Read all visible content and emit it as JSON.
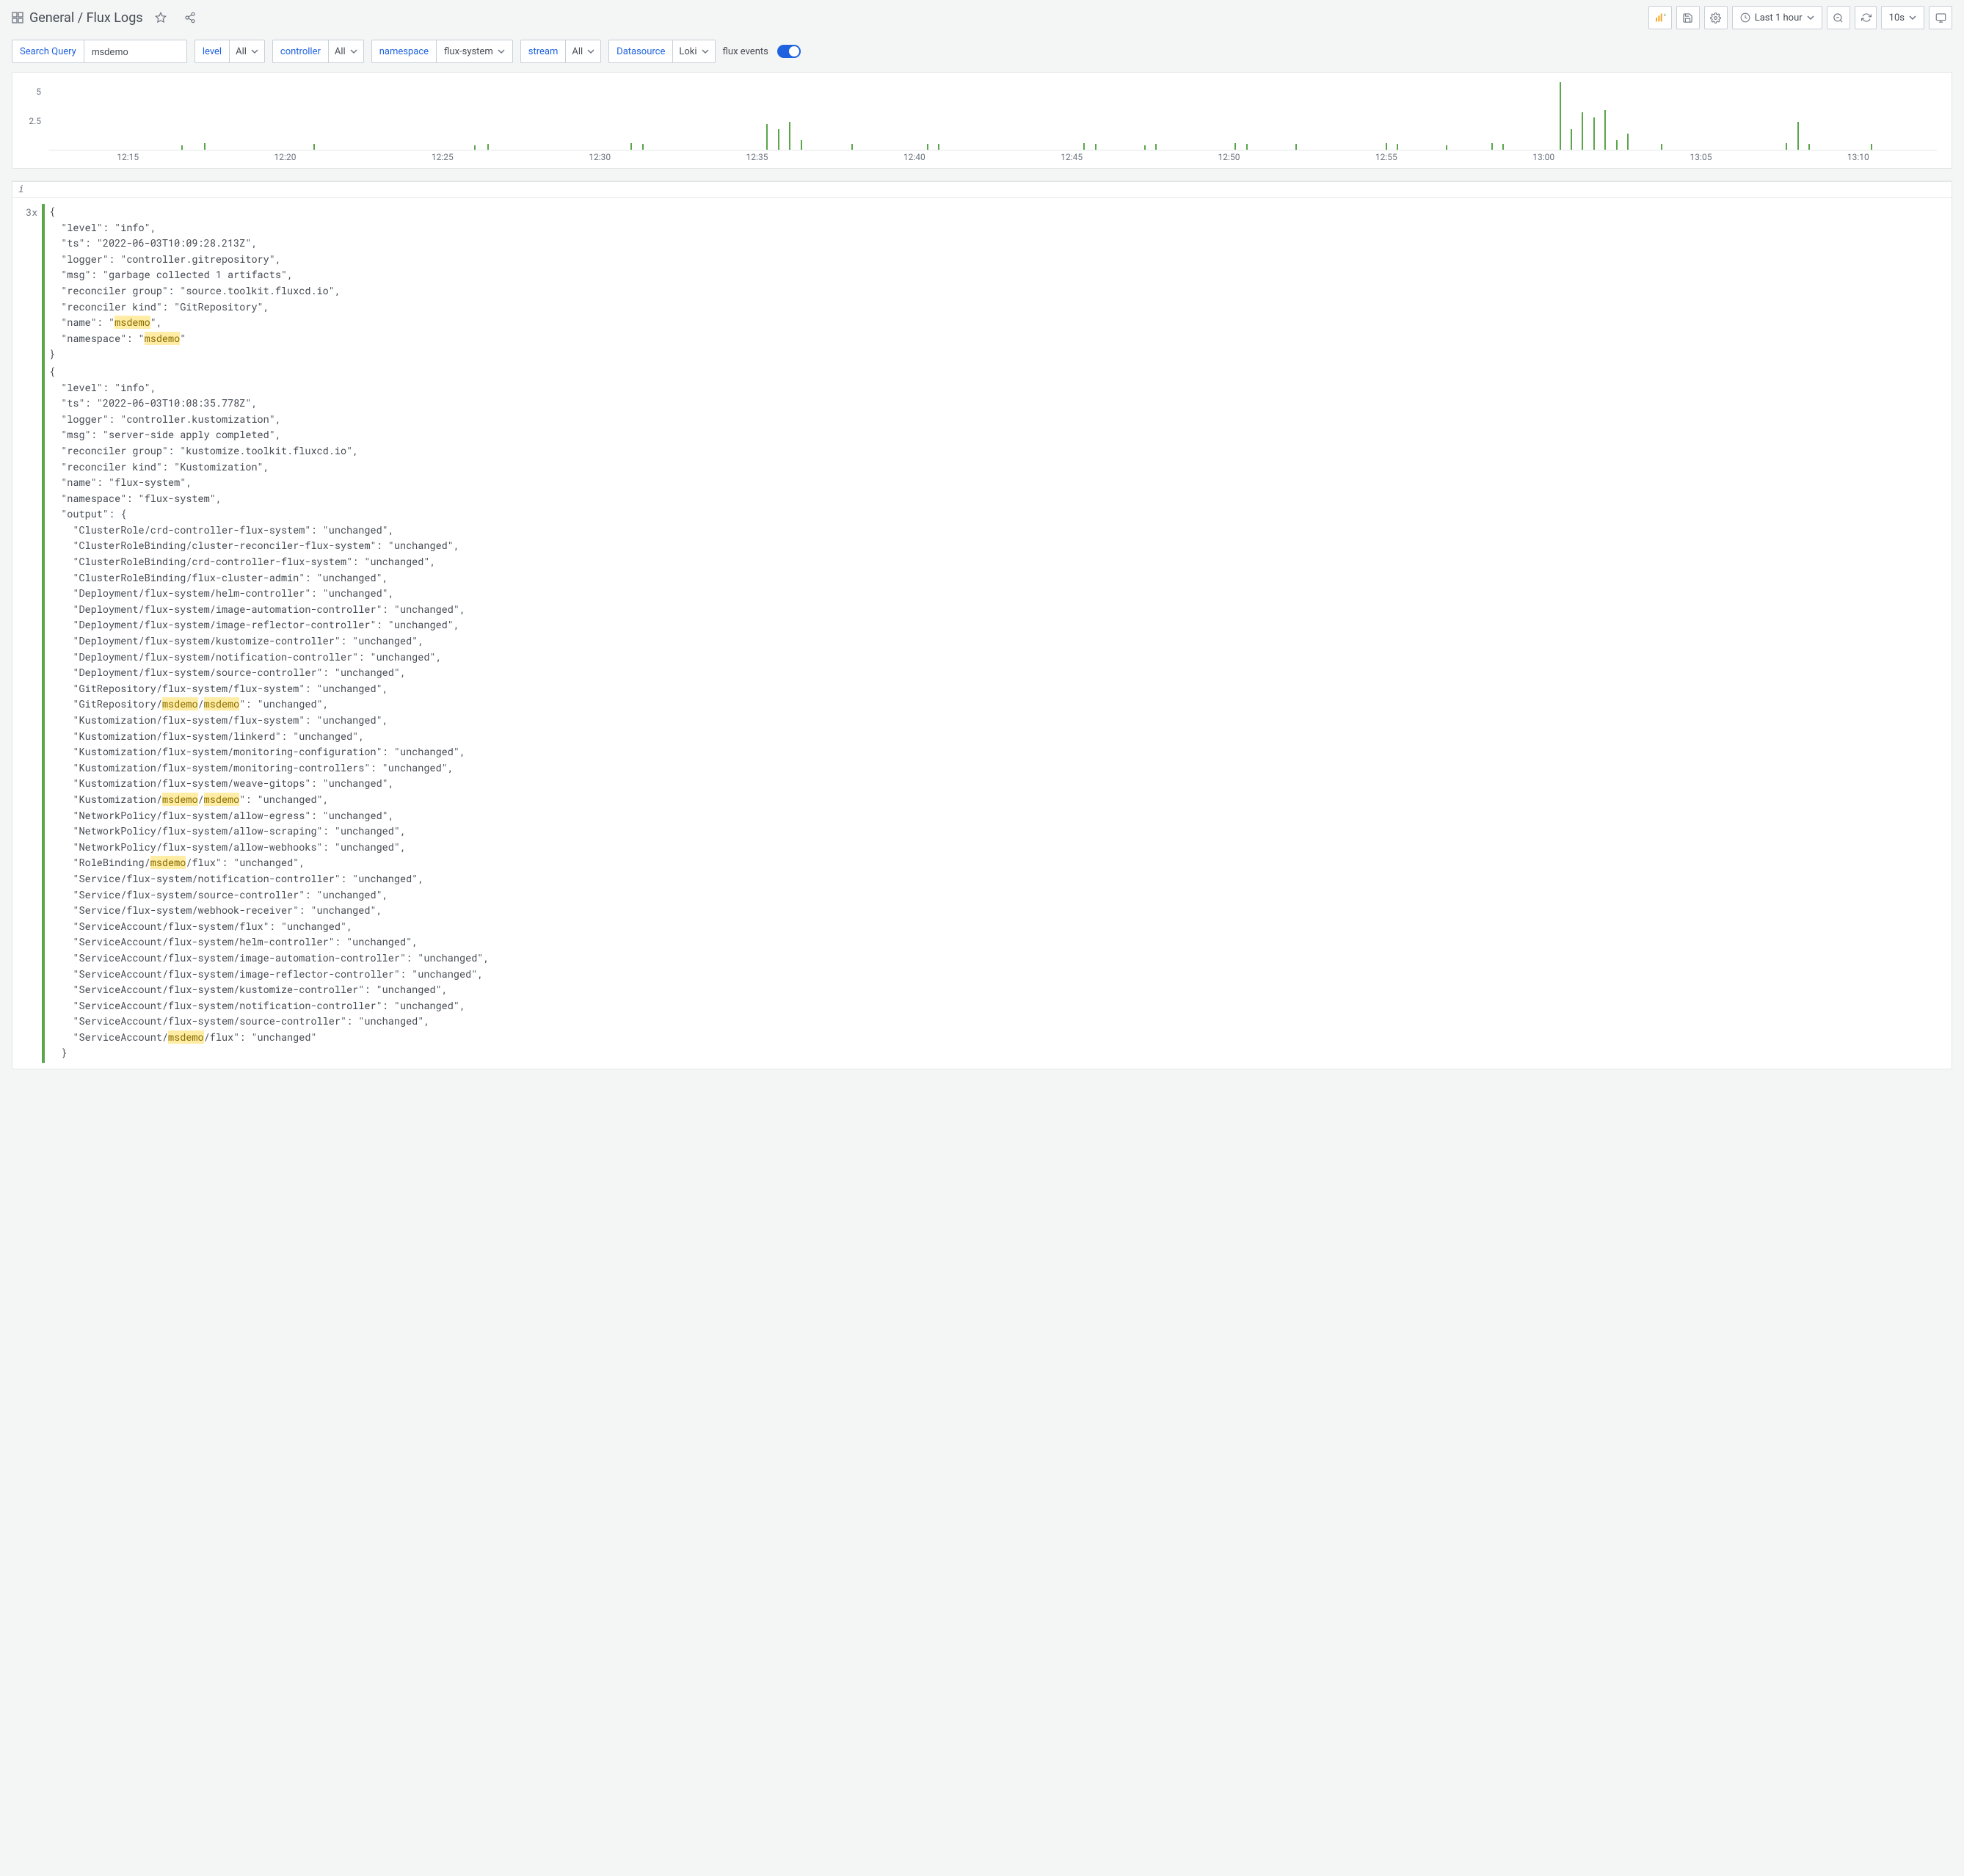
{
  "breadcrumb": {
    "root": "General",
    "page": "Flux Logs"
  },
  "topbar": {
    "time_range": "Last 1 hour",
    "refresh_interval": "10s"
  },
  "filters": {
    "search_label": "Search Query",
    "search_value": "msdemo",
    "level_label": "level",
    "level_value": "All",
    "controller_label": "controller",
    "controller_value": "All",
    "namespace_label": "namespace",
    "namespace_value": "flux-system",
    "stream_label": "stream",
    "stream_value": "All",
    "datasource_label": "Datasource",
    "datasource_value": "Loki",
    "toggle_label": "flux events"
  },
  "info_char": "i",
  "chart_data": {
    "type": "bar",
    "title": "",
    "xlabel": "",
    "ylabel": "",
    "ylim": [
      0,
      6
    ],
    "y_ticks": [
      2.5,
      5
    ],
    "x_ticks": [
      "12:15",
      "12:20",
      "12:25",
      "12:30",
      "12:35",
      "12:40",
      "12:45",
      "12:50",
      "12:55",
      "13:00",
      "13:05",
      "13:10"
    ],
    "x_range": [
      "12:11",
      "13:12"
    ],
    "bars": [
      {
        "x_pct": 7.0,
        "value": 0.4
      },
      {
        "x_pct": 8.2,
        "value": 0.6
      },
      {
        "x_pct": 14.0,
        "value": 0.5
      },
      {
        "x_pct": 22.5,
        "value": 0.4
      },
      {
        "x_pct": 23.2,
        "value": 0.5
      },
      {
        "x_pct": 30.8,
        "value": 0.6
      },
      {
        "x_pct": 31.4,
        "value": 0.5
      },
      {
        "x_pct": 38.0,
        "value": 2.2
      },
      {
        "x_pct": 38.6,
        "value": 1.8
      },
      {
        "x_pct": 39.2,
        "value": 2.4
      },
      {
        "x_pct": 39.8,
        "value": 0.8
      },
      {
        "x_pct": 42.5,
        "value": 0.5
      },
      {
        "x_pct": 46.5,
        "value": 0.5
      },
      {
        "x_pct": 47.1,
        "value": 0.5
      },
      {
        "x_pct": 54.8,
        "value": 0.6
      },
      {
        "x_pct": 55.4,
        "value": 0.5
      },
      {
        "x_pct": 58.0,
        "value": 0.4
      },
      {
        "x_pct": 58.6,
        "value": 0.5
      },
      {
        "x_pct": 62.8,
        "value": 0.6
      },
      {
        "x_pct": 63.4,
        "value": 0.5
      },
      {
        "x_pct": 66.0,
        "value": 0.5
      },
      {
        "x_pct": 70.8,
        "value": 0.6
      },
      {
        "x_pct": 71.4,
        "value": 0.5
      },
      {
        "x_pct": 74.0,
        "value": 0.4
      },
      {
        "x_pct": 76.4,
        "value": 0.6
      },
      {
        "x_pct": 77.0,
        "value": 0.5
      },
      {
        "x_pct": 80.0,
        "value": 5.8
      },
      {
        "x_pct": 80.6,
        "value": 1.8
      },
      {
        "x_pct": 81.2,
        "value": 3.2
      },
      {
        "x_pct": 81.8,
        "value": 2.8
      },
      {
        "x_pct": 82.4,
        "value": 3.4
      },
      {
        "x_pct": 83.0,
        "value": 0.8
      },
      {
        "x_pct": 83.6,
        "value": 1.4
      },
      {
        "x_pct": 85.4,
        "value": 0.5
      },
      {
        "x_pct": 92.0,
        "value": 0.6
      },
      {
        "x_pct": 92.6,
        "value": 2.4
      },
      {
        "x_pct": 93.2,
        "value": 0.5
      },
      {
        "x_pct": 96.5,
        "value": 0.5
      }
    ]
  },
  "logs": [
    {
      "count": "3x",
      "lines": [
        {
          "t": "{"
        },
        {
          "t": "  \"level\": \"info\","
        },
        {
          "t": "  \"ts\": \"2022-06-03T10:09:28.213Z\","
        },
        {
          "t": "  \"logger\": \"controller.gitrepository\","
        },
        {
          "t": "  \"msg\": \"garbage collected 1 artifacts\","
        },
        {
          "t": "  \"reconciler group\": \"source.toolkit.fluxcd.io\","
        },
        {
          "t": "  \"reconciler kind\": \"GitRepository\","
        },
        {
          "segments": [
            "  \"name\": \"",
            {
              "hl": "msdemo"
            },
            "\","
          ]
        },
        {
          "segments": [
            "  \"namespace\": \"",
            {
              "hl": "msdemo"
            },
            "\""
          ]
        },
        {
          "t": "}"
        }
      ]
    },
    {
      "count": "",
      "lines": [
        {
          "t": "{"
        },
        {
          "t": "  \"level\": \"info\","
        },
        {
          "t": "  \"ts\": \"2022-06-03T10:08:35.778Z\","
        },
        {
          "t": "  \"logger\": \"controller.kustomization\","
        },
        {
          "t": "  \"msg\": \"server-side apply completed\","
        },
        {
          "t": "  \"reconciler group\": \"kustomize.toolkit.fluxcd.io\","
        },
        {
          "t": "  \"reconciler kind\": \"Kustomization\","
        },
        {
          "t": "  \"name\": \"flux-system\","
        },
        {
          "t": "  \"namespace\": \"flux-system\","
        },
        {
          "t": "  \"output\": {"
        },
        {
          "t": "    \"ClusterRole/crd-controller-flux-system\": \"unchanged\","
        },
        {
          "t": "    \"ClusterRoleBinding/cluster-reconciler-flux-system\": \"unchanged\","
        },
        {
          "t": "    \"ClusterRoleBinding/crd-controller-flux-system\": \"unchanged\","
        },
        {
          "t": "    \"ClusterRoleBinding/flux-cluster-admin\": \"unchanged\","
        },
        {
          "t": "    \"Deployment/flux-system/helm-controller\": \"unchanged\","
        },
        {
          "t": "    \"Deployment/flux-system/image-automation-controller\": \"unchanged\","
        },
        {
          "t": "    \"Deployment/flux-system/image-reflector-controller\": \"unchanged\","
        },
        {
          "t": "    \"Deployment/flux-system/kustomize-controller\": \"unchanged\","
        },
        {
          "t": "    \"Deployment/flux-system/notification-controller\": \"unchanged\","
        },
        {
          "t": "    \"Deployment/flux-system/source-controller\": \"unchanged\","
        },
        {
          "t": "    \"GitRepository/flux-system/flux-system\": \"unchanged\","
        },
        {
          "segments": [
            "    \"GitRepository/",
            {
              "hl": "msdemo"
            },
            "/",
            {
              "hl": "msdemo"
            },
            "\": \"unchanged\","
          ]
        },
        {
          "t": "    \"Kustomization/flux-system/flux-system\": \"unchanged\","
        },
        {
          "t": "    \"Kustomization/flux-system/linkerd\": \"unchanged\","
        },
        {
          "t": "    \"Kustomization/flux-system/monitoring-configuration\": \"unchanged\","
        },
        {
          "t": "    \"Kustomization/flux-system/monitoring-controllers\": \"unchanged\","
        },
        {
          "t": "    \"Kustomization/flux-system/weave-gitops\": \"unchanged\","
        },
        {
          "segments": [
            "    \"Kustomization/",
            {
              "hl": "msdemo"
            },
            "/",
            {
              "hl": "msdemo"
            },
            "\": \"unchanged\","
          ]
        },
        {
          "t": "    \"NetworkPolicy/flux-system/allow-egress\": \"unchanged\","
        },
        {
          "t": "    \"NetworkPolicy/flux-system/allow-scraping\": \"unchanged\","
        },
        {
          "t": "    \"NetworkPolicy/flux-system/allow-webhooks\": \"unchanged\","
        },
        {
          "segments": [
            "    \"RoleBinding/",
            {
              "hl": "msdemo"
            },
            "/flux\": \"unchanged\","
          ]
        },
        {
          "t": "    \"Service/flux-system/notification-controller\": \"unchanged\","
        },
        {
          "t": "    \"Service/flux-system/source-controller\": \"unchanged\","
        },
        {
          "t": "    \"Service/flux-system/webhook-receiver\": \"unchanged\","
        },
        {
          "t": "    \"ServiceAccount/flux-system/flux\": \"unchanged\","
        },
        {
          "t": "    \"ServiceAccount/flux-system/helm-controller\": \"unchanged\","
        },
        {
          "t": "    \"ServiceAccount/flux-system/image-automation-controller\": \"unchanged\","
        },
        {
          "t": "    \"ServiceAccount/flux-system/image-reflector-controller\": \"unchanged\","
        },
        {
          "t": "    \"ServiceAccount/flux-system/kustomize-controller\": \"unchanged\","
        },
        {
          "t": "    \"ServiceAccount/flux-system/notification-controller\": \"unchanged\","
        },
        {
          "t": "    \"ServiceAccount/flux-system/source-controller\": \"unchanged\","
        },
        {
          "segments": [
            "    \"ServiceAccount/",
            {
              "hl": "msdemo"
            },
            "/flux\": \"unchanged\""
          ]
        },
        {
          "t": "  }"
        }
      ]
    }
  ]
}
